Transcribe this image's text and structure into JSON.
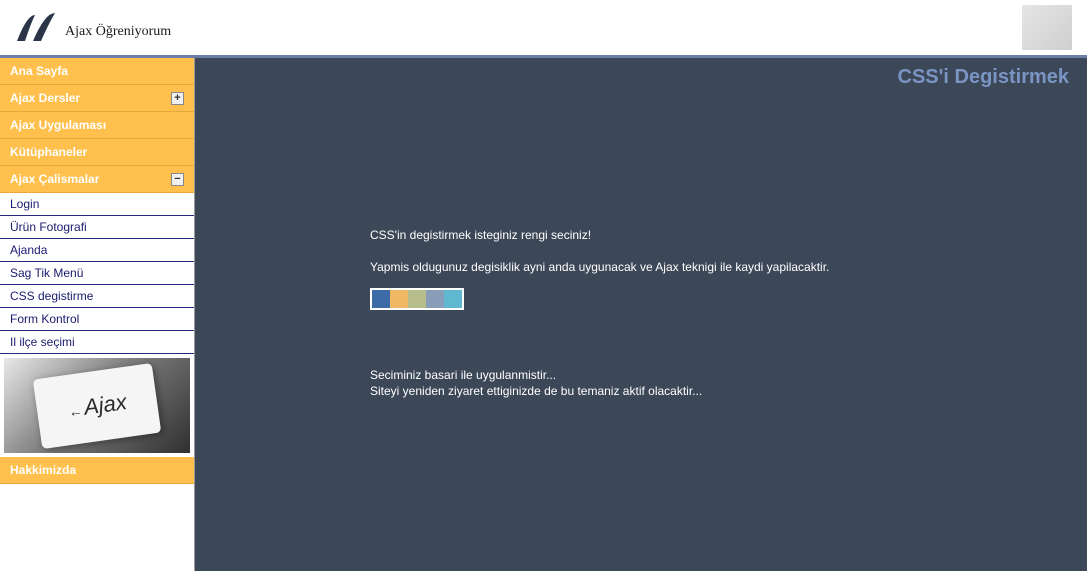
{
  "header": {
    "logo_text": "Ajax Öğreniyorum"
  },
  "sidebar": {
    "nav": [
      {
        "label": "Ana Sayfa",
        "expand": null
      },
      {
        "label": "Ajax Dersler",
        "expand": "+"
      },
      {
        "label": "Ajax Uygulaması",
        "expand": null
      },
      {
        "label": "Kütüphaneler",
        "expand": null
      },
      {
        "label": "Ajax Çalismalar",
        "expand": "−"
      }
    ],
    "subnav": [
      {
        "label": "Login"
      },
      {
        "label": "Ürün Fotografi"
      },
      {
        "label": "Ajanda"
      },
      {
        "label": "Sag Tik Menü"
      },
      {
        "label": "CSS degistirme"
      },
      {
        "label": "Form Kontrol"
      },
      {
        "label": "Il ilçe seçimi"
      }
    ],
    "bottom_nav": [
      {
        "label": "Hakkimizda"
      }
    ],
    "image_text": "Ajax"
  },
  "content": {
    "page_title": "CSS'i Degistirmek",
    "instruction_1": "CSS'in degistirmek isteginiz rengi seciniz!",
    "instruction_2": "Yapmis oldugunuz degisiklik ayni anda uygunacak ve Ajax teknigi ile kaydi yapilacaktir.",
    "swatches": [
      {
        "color": "#3c6ba8"
      },
      {
        "color": "#f0b863"
      },
      {
        "color": "#b8bd8c"
      },
      {
        "color": "#8a9db8"
      },
      {
        "color": "#5db8d0"
      }
    ],
    "status_1": "Seciminiz basari ile uygulanmistir...",
    "status_2": "Siteyi yeniden ziyaret ettiginizde de bu temaniz aktif olacaktir..."
  }
}
